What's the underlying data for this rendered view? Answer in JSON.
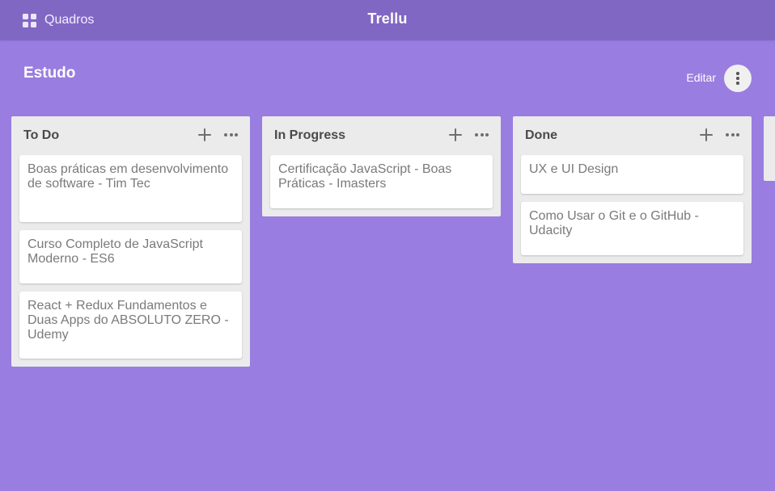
{
  "header": {
    "boards_label": "Quadros",
    "app_title": "Trellu"
  },
  "board": {
    "title": "Estudo",
    "edit_label": "Editar"
  },
  "lists": [
    {
      "title": "To Do",
      "cards": [
        "Boas práticas em desenvolvimento de software - Tim Tec",
        "Curso Completo de JavaScript Moderno - ES6",
        "React + Redux Fundamentos e Duas Apps do ABSOLUTO ZERO - Udemy"
      ]
    },
    {
      "title": "In Progress",
      "cards": [
        "Certificação JavaScript - Boas Práticas - Imasters"
      ]
    },
    {
      "title": "Done",
      "cards": [
        "UX e UI Design",
        "Como Usar o Git e o GitHub - Udacity"
      ]
    }
  ],
  "icons": {
    "boards": "grid-icon",
    "more_board": "vertical-dots-icon",
    "add_card": "plus-icon",
    "list_menu": "horizontal-dots-icon"
  },
  "colors": {
    "background": "#9a7de0",
    "topbar": "#8167c4",
    "list_bg": "#ebebeb",
    "card_bg": "#ffffff"
  }
}
